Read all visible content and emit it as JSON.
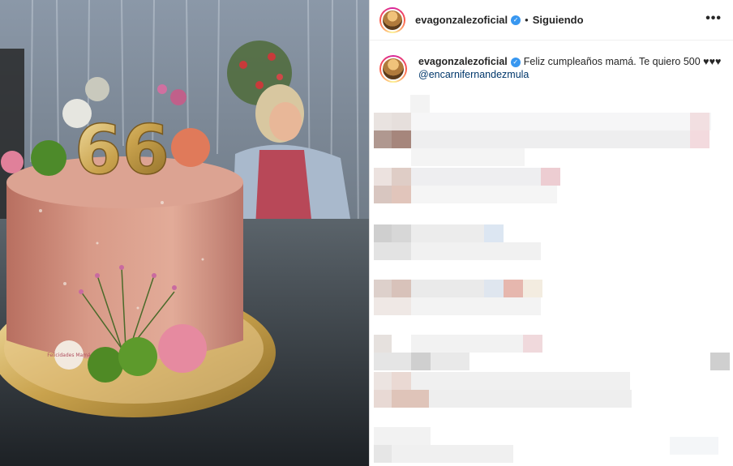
{
  "header": {
    "username": "evagonzalezoficial",
    "separator": "•",
    "follow_status": "Siguiendo",
    "more_icon": "more-options-icon",
    "more_glyph": "•••"
  },
  "caption": {
    "username": "evagonzalezoficial",
    "text": "Feliz cumpleaños mamá. Te quiero 500 ♥♥♥",
    "mention": "@encarnifernandezmula"
  },
  "media": {
    "cake_number": "66",
    "cake_tag": "Felicidades Mamá"
  },
  "colors": {
    "verified_blue": "#3897f0",
    "mention_blue": "#00376b",
    "cake_pink": "#d89a88"
  }
}
